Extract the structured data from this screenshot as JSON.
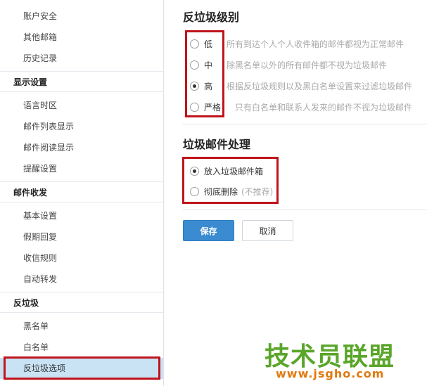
{
  "sidebar": {
    "items": [
      {
        "label": "账户安全",
        "type": "item"
      },
      {
        "label": "其他邮箱",
        "type": "item"
      },
      {
        "label": "历史记录",
        "type": "item"
      },
      {
        "label": "显示设置",
        "type": "head"
      },
      {
        "label": "语言时区",
        "type": "item"
      },
      {
        "label": "邮件列表显示",
        "type": "item"
      },
      {
        "label": "邮件阅读显示",
        "type": "item"
      },
      {
        "label": "提醒设置",
        "type": "item"
      },
      {
        "label": "邮件收发",
        "type": "head"
      },
      {
        "label": "基本设置",
        "type": "item"
      },
      {
        "label": "假期回复",
        "type": "item"
      },
      {
        "label": "收信规则",
        "type": "item"
      },
      {
        "label": "自动转发",
        "type": "item"
      },
      {
        "label": "反垃圾",
        "type": "head"
      },
      {
        "label": "黑名单",
        "type": "item"
      },
      {
        "label": "白名单",
        "type": "item"
      },
      {
        "label": "反垃圾选项",
        "type": "item",
        "active": true
      }
    ]
  },
  "spam_level": {
    "title": "反垃圾级别",
    "options": [
      {
        "label": "低",
        "desc": "所有到达个人个人收件箱的邮件都视为正常邮件",
        "checked": false
      },
      {
        "label": "中",
        "desc": "除黑名单以外的所有邮件都不视为垃圾邮件",
        "checked": false
      },
      {
        "label": "高",
        "desc": "根据反垃圾规则以及黑白名单设置来过滤垃圾邮件",
        "checked": true
      },
      {
        "label": "严格",
        "desc": "只有白名单和联系人发来的邮件不视为垃圾邮件",
        "checked": false
      }
    ]
  },
  "spam_handling": {
    "title": "垃圾邮件处理",
    "options": [
      {
        "label": "放入垃圾邮件箱",
        "note": "",
        "checked": true
      },
      {
        "label": "彻底删除",
        "note": "(不推荐)",
        "checked": false
      }
    ]
  },
  "actions": {
    "save_label": "保存",
    "cancel_label": "取消"
  },
  "watermark": {
    "brand": "技术员联盟",
    "url": "www.jsgho.com"
  },
  "colors": {
    "accent": "#3b8bd1",
    "highlight_outline": "#c0141b",
    "active_item_bg": "#c9e3f5"
  }
}
